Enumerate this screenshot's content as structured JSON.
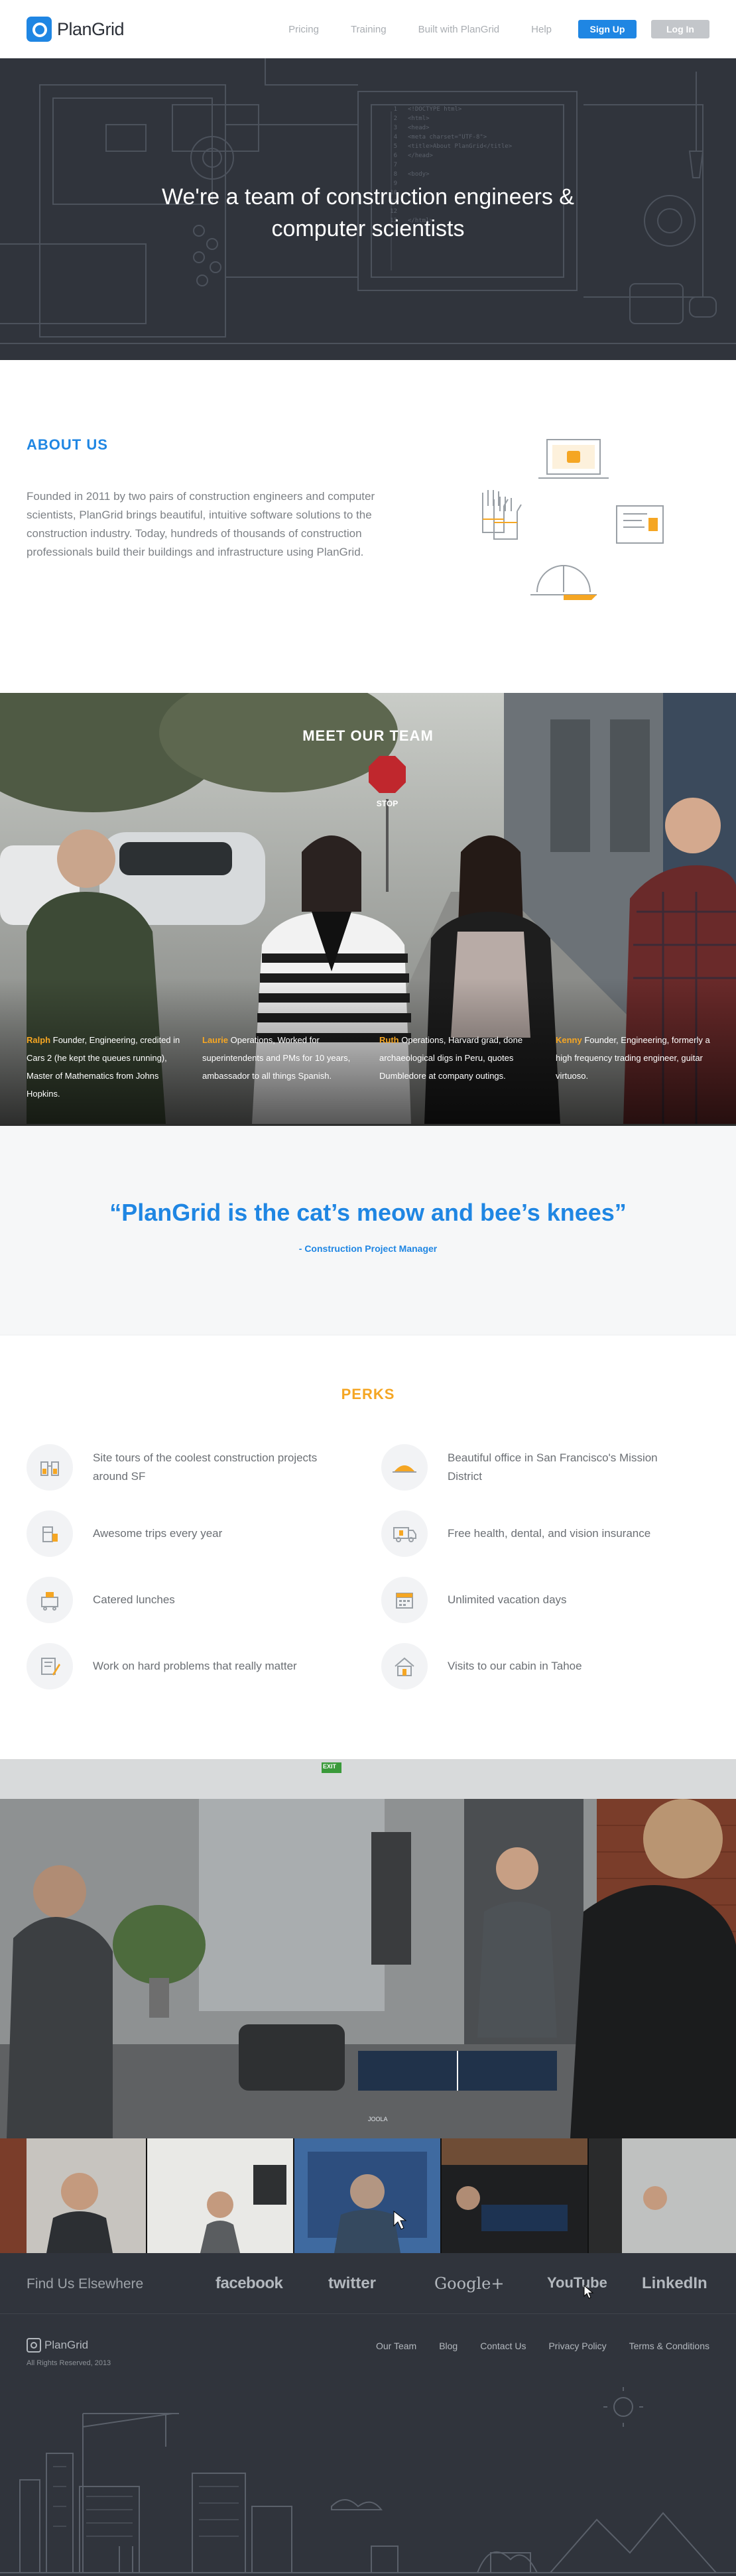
{
  "header": {
    "logo_text": "PlanGrid",
    "nav": [
      "Pricing",
      "Training",
      "Built with PlanGrid",
      "Help"
    ],
    "signup_label": "Sign Up",
    "login_label": "Log In"
  },
  "hero": {
    "title_line1": "We're a team of construction engineers &",
    "title_line2": "computer scientists",
    "code_lines": [
      "<!DOCTYPE html>",
      "<html>",
      "<head>",
      "<meta charset=\"UTF-8\">",
      "<title>About PlanGrid</title>",
      "</head>",
      "",
      "<body>",
      "",
      "",
      "",
      "",
      "</html>"
    ],
    "line_numbers": [
      "1",
      "2",
      "3",
      "4",
      "5",
      "6",
      "7",
      "8",
      "9",
      "10",
      "11",
      "12",
      "13"
    ]
  },
  "about": {
    "title": "ABOUT US",
    "text": "Founded in 2011 by two pairs of construction engineers and computer scientists, PlanGrid brings beautiful, intuitive software solutions to the construction industry. Today, hundreds of thousands of construction professionals build their buildings and infrastructure using PlanGrid."
  },
  "team": {
    "title": "MEET OUR TEAM",
    "members": [
      {
        "name": "Ralph",
        "bio": "Founder, Engineering, credited in Cars 2 (he kept the queues running), Master of Mathematics from Johns Hopkins."
      },
      {
        "name": "Laurie",
        "bio": "Operations, Worked for superintendents and PMs for 10 years, ambassador to all things Spanish."
      },
      {
        "name": "Ruth",
        "bio": "Operations, Harvard grad, done archaeological digs in Peru, quotes Dumbledore at company outings."
      },
      {
        "name": "Kenny",
        "bio": "Founder, Engineering, formerly a high frequency trading engineer, guitar virtuoso."
      }
    ],
    "stop_sign": "STOP"
  },
  "quote": {
    "text": "“PlanGrid is the cat’s meow and bee’s knees”",
    "author": "- Construction Project Manager"
  },
  "perks": {
    "title": "PERKS",
    "items": [
      {
        "icon": "binoculars-icon",
        "text": "Site tours of the coolest construction projects around SF"
      },
      {
        "icon": "golden-gate-icon",
        "text": "Beautiful office in San Francisco's Mission District"
      },
      {
        "icon": "plane-icon",
        "text": "Awesome trips every year"
      },
      {
        "icon": "ambulance-icon",
        "text": "Free health, dental, and vision insurance"
      },
      {
        "icon": "lunch-cart-icon",
        "text": "Catered lunches"
      },
      {
        "icon": "calendar-icon",
        "text": "Unlimited vacation days"
      },
      {
        "icon": "blueprint-pencil-icon",
        "text": "Work on hard problems that really matter"
      },
      {
        "icon": "cabin-icon",
        "text": "Visits to our cabin in Tahoe"
      }
    ]
  },
  "office": {
    "exit_sign": "EXIT",
    "table_text": "JOOLA"
  },
  "social": {
    "label": "Find Us Elsewhere",
    "networks": [
      "facebook",
      "twitter",
      "Google+",
      "YouTube",
      "LinkedIn"
    ]
  },
  "footer": {
    "logo_text": "PlanGrid",
    "copyright": "All Rights Reserved, 2013",
    "links": [
      "Our Team",
      "Blog",
      "Contact Us",
      "Privacy Policy",
      "Terms & Conditions"
    ]
  },
  "colors": {
    "brand_blue": "#1f86e3",
    "accent_orange": "#f5a623",
    "dark_slate": "#30343c"
  }
}
